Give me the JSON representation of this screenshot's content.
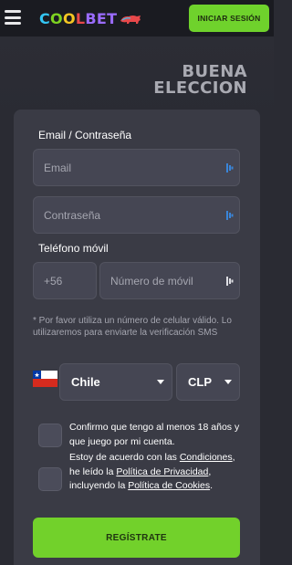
{
  "header": {
    "logo": {
      "parts": [
        "C",
        "O",
        "O",
        "L",
        "BET"
      ]
    },
    "login_label": "INICIAR SESIÓN"
  },
  "hero": {
    "line1": "BUENA",
    "line2": "ELECCION"
  },
  "form": {
    "email_section_label": "Email / Contraseña",
    "email_placeholder": "Email",
    "password_placeholder": "Contraseña",
    "phone_section_label": "Teléfono móvil",
    "phone_prefix": "+56",
    "phone_placeholder": "Número de móvil",
    "helper_text": "* Por favor utiliza un número de celular válido. Lo utilizaremos para enviarte la verificación SMS",
    "country_value": "Chile",
    "currency_value": "CLP",
    "age_consent": "Confirmo que tengo al menos 18 años y que juego por mi cuenta.",
    "terms_prefix": "Estoy de acuerdo con las ",
    "terms_link": "Condiciones",
    "terms_middle": ", he leído la ",
    "privacy_link": "Política de Privacidad",
    "terms_middle2": ", incluyendo la ",
    "cookies_link": "Política de Cookies",
    "terms_suffix": ".",
    "register_label": "REGÍSTRATE"
  },
  "colors": {
    "accent_green": "#72d12b",
    "background": "#2a2b33",
    "card": "#3a3b45",
    "field": "#454653"
  },
  "icons": {
    "menu": "hamburger-icon",
    "field_key": "key-icon",
    "caret": "chevron-down-icon",
    "flag": "chile-flag-icon"
  }
}
